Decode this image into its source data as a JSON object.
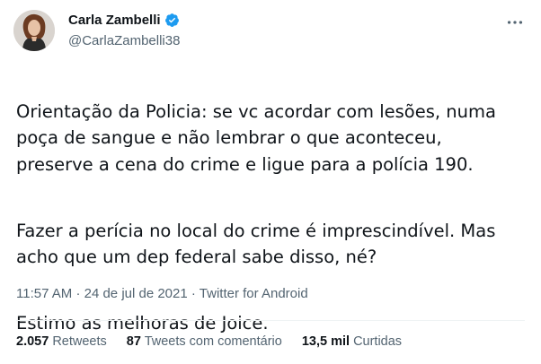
{
  "author": {
    "display_name": "Carla Zambelli",
    "handle": "@CarlaZambelli38",
    "verified": true,
    "avatar_icon": "profile-photo"
  },
  "more_icon": "more-horizontal-icon",
  "tweet": {
    "paragraph1": "Orientação da Policia: se vc acordar com lesões, numa\npoça de sangue e não lembrar o que aconteceu,\npreserve a cena do crime e ligue para a polícia 190.",
    "paragraph2": "Fazer a perícia no local do crime é imprescindível. Mas\nacho que um dep federal sabe disso, né?",
    "paragraph3": "Estimo as melhoras de Joice."
  },
  "meta": {
    "time": "11:57 AM",
    "separator": "·",
    "date": "24 de jul de 2021",
    "source": "Twitter for Android"
  },
  "stats": {
    "retweets_count": "2.057",
    "retweets_label": "Retweets",
    "quotes_count": "87",
    "quotes_label": "Tweets com comentário",
    "likes_count": "13,5 mil",
    "likes_label": "Curtidas"
  },
  "colors": {
    "text": "#0f1419",
    "secondary": "#536471",
    "verified_badge": "#1d9bf0",
    "divider": "#eff3f4"
  }
}
